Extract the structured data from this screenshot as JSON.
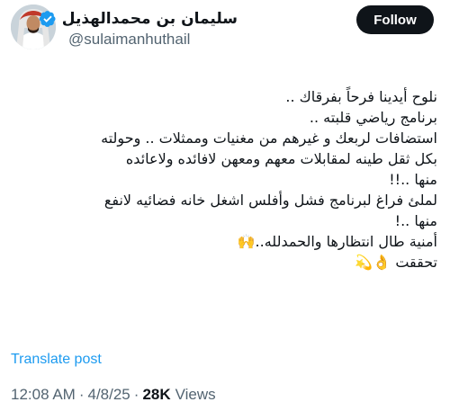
{
  "author": {
    "display_name": "سليمان بن محمدالهذيل",
    "handle": "@sulaimanhuthail",
    "verified": true,
    "avatar_icon": "profile-photo"
  },
  "follow_button": {
    "label": "Follow"
  },
  "tweet": {
    "lines": [
      "نلوح أيدينا فرحاً بفرقاك ..",
      "برنامج رياضي قلبته ..",
      "استضافات لربعك و غيرهم من مغنيات وممثلات .. وحولته",
      "بكل ثقل طينه لمقابلات معهم ومعهن لافائده ولاعائده",
      "منها ..!!",
      "لملئ فراغ لبرنامج فشل وأفلس اشغل خانه فضائيه لانفع",
      "منها ..!",
      "أمنية طال انتظارها والحمدلله..🙌",
      "تحققت 👌💫"
    ]
  },
  "translate": {
    "label": "Translate post"
  },
  "meta": {
    "time": "12:08 AM",
    "separator": "·",
    "date": "4/8/25",
    "views_count": "28K",
    "views_label": "Views"
  },
  "colors": {
    "text": "#0f1419",
    "secondary": "#536471",
    "link": "#1d9bf0",
    "verified": "#1d9bf0",
    "follow_bg": "#0f1419"
  }
}
